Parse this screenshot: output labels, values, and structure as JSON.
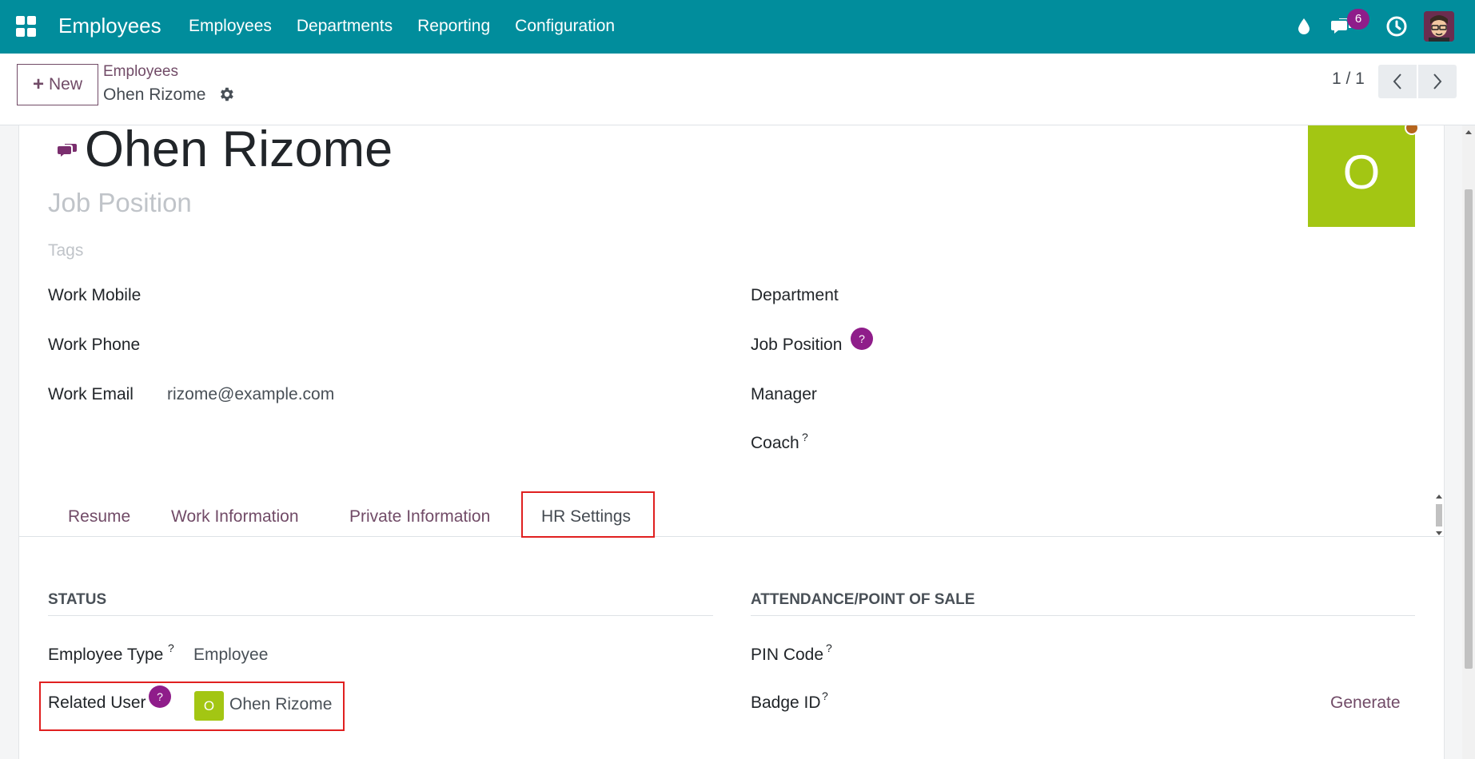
{
  "navbar": {
    "app_title": "Employees",
    "menu": [
      "Employees",
      "Departments",
      "Reporting",
      "Configuration"
    ],
    "messages_count": "6",
    "background_color": "#018d9c"
  },
  "control_panel": {
    "new_label": "New",
    "breadcrumb_parent": "Employees",
    "breadcrumb_current": "Ohen Rizome",
    "pager": "1 / 1"
  },
  "form": {
    "employee_name": "Ohen Rizome",
    "job_position_placeholder": "Job Position",
    "tags_placeholder": "Tags",
    "avatar_letter": "O",
    "left_fields": {
      "work_mobile_label": "Work Mobile",
      "work_phone_label": "Work Phone",
      "work_email_label": "Work Email",
      "work_email_value": "rizome@example.com"
    },
    "right_fields": {
      "department_label": "Department",
      "job_position_label": "Job Position",
      "manager_label": "Manager",
      "coach_label": "Coach"
    },
    "help_mark": "?",
    "tabs": [
      "Resume",
      "Work Information",
      "Private Information",
      "HR Settings"
    ],
    "active_tab": "HR Settings",
    "status_section": {
      "title": "STATUS",
      "employee_type_label": "Employee Type",
      "employee_type_value": "Employee",
      "related_user_label": "Related User",
      "related_user_initial": "O",
      "related_user_value": "Ohen Rizome"
    },
    "attendance_section": {
      "title": "ATTENDANCE/POINT OF SALE",
      "pin_code_label": "PIN Code",
      "badge_id_label": "Badge ID",
      "generate_label": "Generate"
    }
  },
  "colors": {
    "accent": "#714b67",
    "help_badge": "#8f1d8a",
    "avatar_green": "#a3c613",
    "highlight_red": "#e02020"
  }
}
